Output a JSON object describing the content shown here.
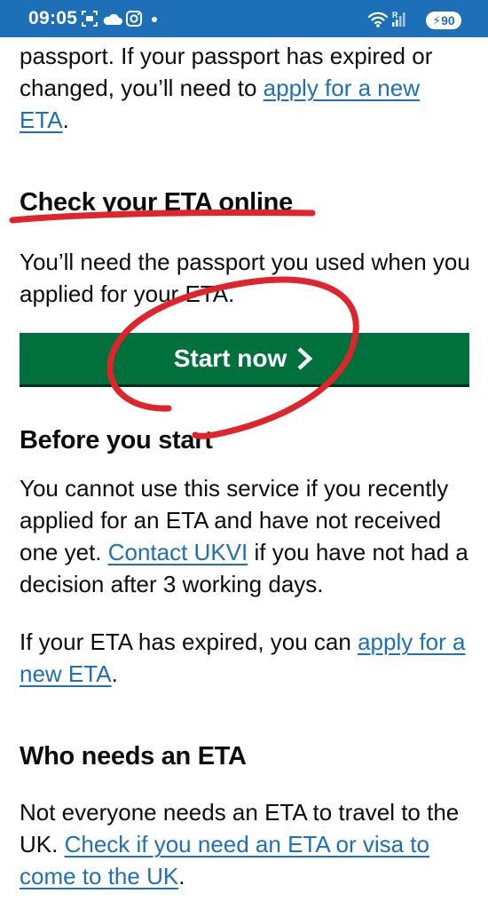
{
  "status_bar": {
    "time": "09:05",
    "battery": "90"
  },
  "intro": {
    "text_before": "passport. If your passport has expired or changed, you’ll need to ",
    "link": "apply for a new ETA",
    "text_after": "."
  },
  "check_section": {
    "heading": "Check your ETA online",
    "text": "You’ll need the passport you used when you applied for your ETA.",
    "button_label": "Start now"
  },
  "before_section": {
    "heading": "Before you start",
    "p1_before": "You cannot use this service if you recently applied for an ETA and have not received one yet. ",
    "p1_link": "Contact UKVI",
    "p1_after": " if you have not had a decision after 3 working days.",
    "p2_before": "If your ETA has expired, you can ",
    "p2_link": "apply for a new ETA",
    "p2_after": "."
  },
  "who_section": {
    "heading": "Who needs an ETA",
    "text_before": "Not everyone needs an ETA to travel to the UK. ",
    "link": "Check if you need an ETA or visa to come to the UK",
    "text_after": "."
  },
  "colors": {
    "status_bar": "#1d70b8",
    "link": "#1d70b8",
    "button": "#00703c",
    "annotation": "#e0242b"
  }
}
